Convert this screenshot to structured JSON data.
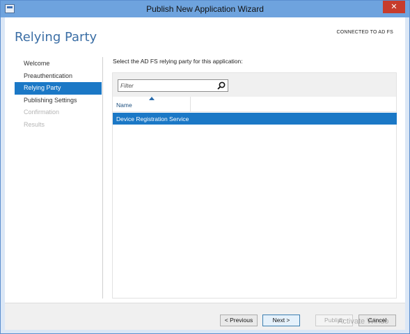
{
  "window": {
    "title": "Publish New Application Wizard",
    "close_glyph": "✕"
  },
  "header": {
    "title": "Relying Party",
    "connection_status": "CONNECTED TO AD FS"
  },
  "nav": {
    "items": [
      {
        "label": "Welcome",
        "state": "normal"
      },
      {
        "label": "Preauthentication",
        "state": "normal"
      },
      {
        "label": "Relying Party",
        "state": "active"
      },
      {
        "label": "Publishing Settings",
        "state": "normal"
      },
      {
        "label": "Confirmation",
        "state": "disabled"
      },
      {
        "label": "Results",
        "state": "disabled"
      }
    ]
  },
  "main": {
    "instruction": "Select the AD FS relying party for this application:",
    "filter": {
      "placeholder": "Filter",
      "value": ""
    },
    "columns": [
      {
        "label": "Name",
        "sort": "ascending"
      }
    ],
    "rows": [
      {
        "name": "Device Registration Service",
        "selected": true
      }
    ]
  },
  "buttons": {
    "previous": "< Previous",
    "next": "Next >",
    "publish": "Publish",
    "cancel": "Cancel"
  },
  "watermark": "Activate Windo",
  "colors": {
    "title_bar": "#6ea3de",
    "accent": "#1b78c6",
    "header_text": "#3b6ea5",
    "close_button": "#c73c2c"
  },
  "icons": {
    "app": "wizard-app-icon",
    "close": "close-icon",
    "search": "search-icon",
    "sort": "sort-ascending-icon"
  }
}
